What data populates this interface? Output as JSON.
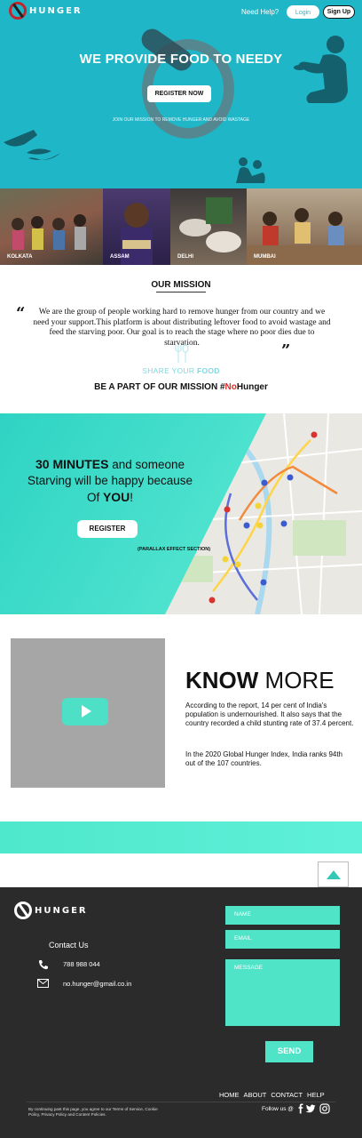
{
  "nav": {
    "brand": "HUNGER",
    "need_help": "Need Help?",
    "login": "Login",
    "signup": "Sign Up"
  },
  "hero": {
    "title": "WE PROVIDE FOOD TO NEEDY",
    "cta": "REGISTER NOW",
    "subtitle": "JOIN OUR MISSION TO REMOVE HUNGER AND AVOID WASTAGE"
  },
  "gallery": [
    {
      "label": "KOLKATA"
    },
    {
      "label": "ASSAM"
    },
    {
      "label": "DELHI"
    },
    {
      "label": "MUMBAI"
    }
  ],
  "mission": {
    "title": "OUR MISSION",
    "quote_open": "“",
    "quote_close": "”",
    "text": "We are the group of people working hard to remove hunger from our country and we need your support.This platform is about distributing leftover food to avoid wastage and feed the starving poor. Our goal is to reach the stage where no poor dies due to starvation.",
    "share_prefix": "SHARE YOUR ",
    "share_strong": "FOOD",
    "be_part_prefix": "BE A PART OF OUR MISSION #",
    "be_part_red": "No",
    "be_part_suffix": "Hunger"
  },
  "parallax": {
    "line1_bold": "30 MINUTES",
    "line1_rest": " and someone",
    "line2": "Starving will be happy because",
    "line3_prefix": "Of ",
    "line3_bold": "YOU",
    "line3_suffix": "!",
    "cta": "REGISTER",
    "note": "(PARALLAX EFFECT SECTION)"
  },
  "know_more": {
    "title_bold": "KNOW",
    "title_rest": " MORE",
    "p1": "According to the report, 14 per cent of India's population is undernourished. It also says that the country recorded a child stunting rate of 37.4 percent.",
    "p2": "In the 2020 Global Hunger Index, India ranks 94th out of the 107 countries."
  },
  "footer": {
    "brand": "HUNGER",
    "contact_title": "Contact Us",
    "phone": "788 988 044",
    "email": "no.hunger@gmail.co.in",
    "name_placeholder": "NAME",
    "email_placeholder": "EMAIL",
    "message_placeholder": "MESSAGE",
    "send": "SEND",
    "links": [
      "HOME",
      "ABOUT",
      "CONTACT",
      "HELP"
    ],
    "legal": "By continuing past this page, you agree to our Terms of Service, Cookie Policy, Privacy Policy and Content Policies.",
    "follow": "Follow us @"
  },
  "colors": {
    "hero_bg": "#1fb7c8",
    "accent": "#4fe3c8",
    "footer_bg": "#2b2b2b",
    "red": "#e02b27"
  }
}
